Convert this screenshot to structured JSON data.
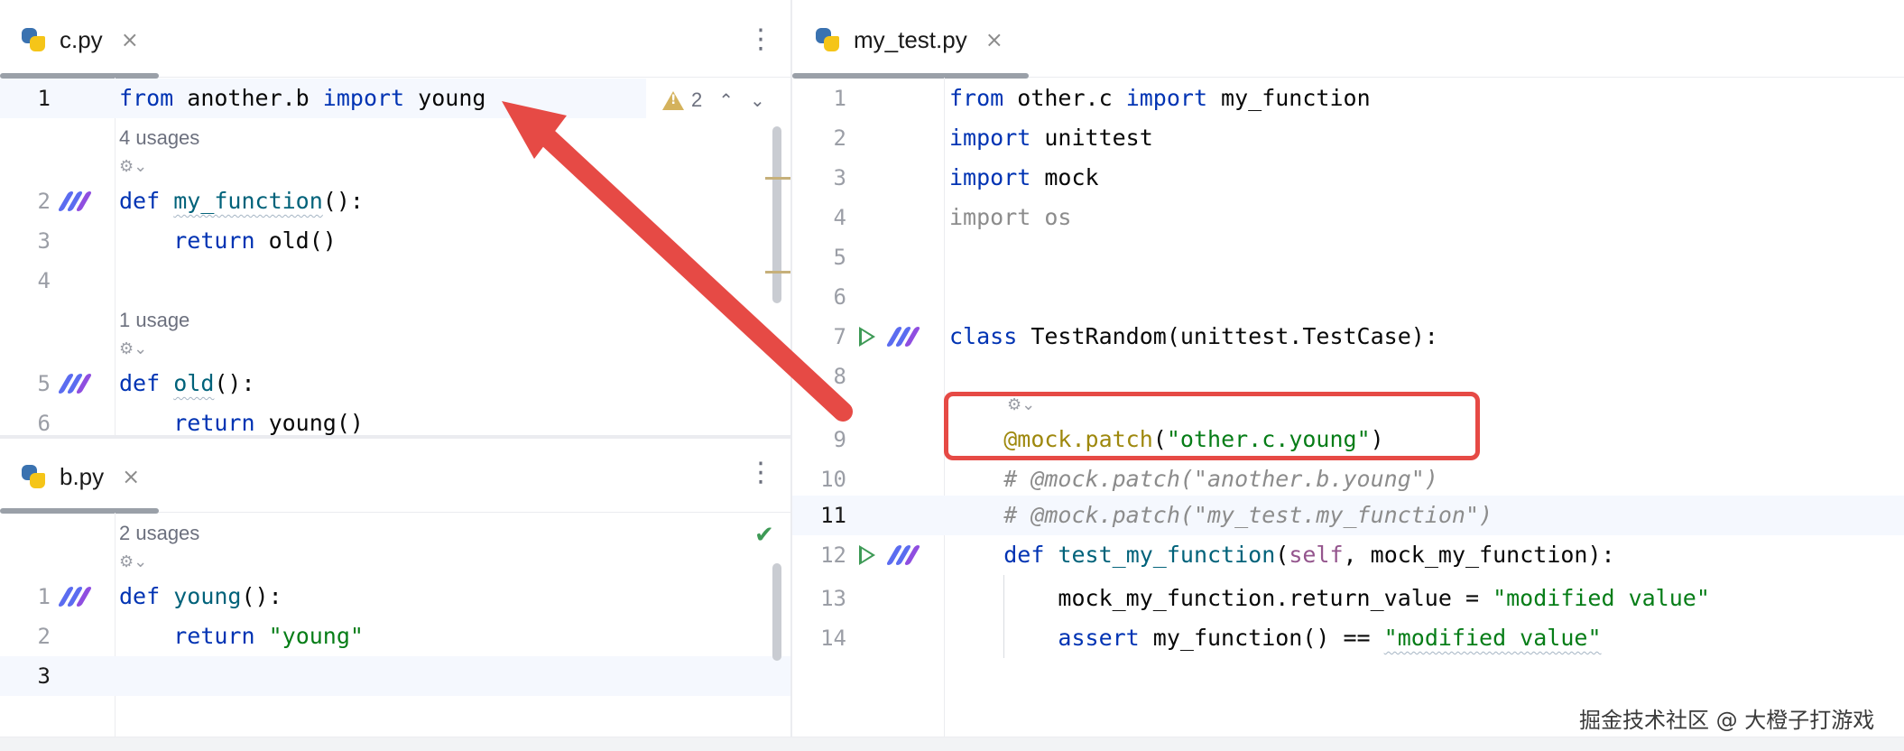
{
  "left_top_pane": {
    "tab": {
      "label": "c.py",
      "close": "×"
    },
    "more": "⋮",
    "warnings": {
      "count": "2"
    },
    "lines": [
      {
        "n": "1"
      },
      {
        "n": "2"
      },
      {
        "n": "3"
      },
      {
        "n": "4"
      },
      {
        "n": "5"
      },
      {
        "n": "6"
      }
    ],
    "hints": [
      "4 usages",
      "1 usage"
    ],
    "code": {
      "l1_from": "from",
      "l1_mod": " another.b ",
      "l1_import": "import",
      "l1_name": " young",
      "l2_def": "def",
      "l2_fn": "my_function",
      "l2_rest": "():",
      "l3_ret": "return",
      "l3_rest": " old()",
      "l5_def": "def",
      "l5_fn": "old",
      "l5_rest": "():",
      "l6_ret": "return",
      "l6_rest": " young()"
    }
  },
  "left_bottom_pane": {
    "tab": {
      "label": "b.py",
      "close": "×"
    },
    "more": "⋮",
    "lines": [
      {
        "n": "1"
      },
      {
        "n": "2"
      },
      {
        "n": "3"
      }
    ],
    "hints": [
      "2 usages"
    ],
    "code": {
      "l1_def": "def",
      "l1_fn": "young",
      "l1_rest": "():",
      "l2_ret": "return",
      "l2_str": "\"young\""
    }
  },
  "right_pane": {
    "tab": {
      "label": "my_test.py",
      "close": "×"
    },
    "lines": [
      {
        "n": "1"
      },
      {
        "n": "2"
      },
      {
        "n": "3"
      },
      {
        "n": "4"
      },
      {
        "n": "5"
      },
      {
        "n": "6"
      },
      {
        "n": "7"
      },
      {
        "n": "8"
      },
      {
        "n": "9"
      },
      {
        "n": "10"
      },
      {
        "n": "11"
      },
      {
        "n": "12"
      },
      {
        "n": "13"
      },
      {
        "n": "14"
      }
    ],
    "code": {
      "l1_from": "from",
      "l1_mod": " other.c ",
      "l1_import": "import",
      "l1_name": " my_function",
      "l2_import": "import",
      "l2_name": " unittest",
      "l3_import": "import",
      "l3_name": " mock",
      "l4_text": "import os",
      "l7_class": "class",
      "l7_rest": " TestRandom(unittest.TestCase):",
      "l9_dec": "@mock.patch",
      "l9_open": "(",
      "l9_str": "\"other.c.young\"",
      "l9_close": ")",
      "l10_cm": "# @mock.patch(\"another.b.young\")",
      "l11_cm": "# @mock.patch(\"my_test.my_function\")",
      "l12_def": "def",
      "l12_fn": "test_my_function",
      "l12_open": "(",
      "l12_self": "self",
      "l12_rest": ", mock_my_function):",
      "l13_pre": "mock_my_function.return_value = ",
      "l13_str": "\"modified value\"",
      "l14_assert": "assert",
      "l14_mid": " my_function() == ",
      "l14_str": "\"modified value\""
    }
  },
  "watermark": "掘金技术社区 @ 大橙子打游戏",
  "colors": {
    "annotation": "#e64a45",
    "keyword": "#0033b3",
    "string": "#067d17",
    "run": "#3e9a56"
  }
}
